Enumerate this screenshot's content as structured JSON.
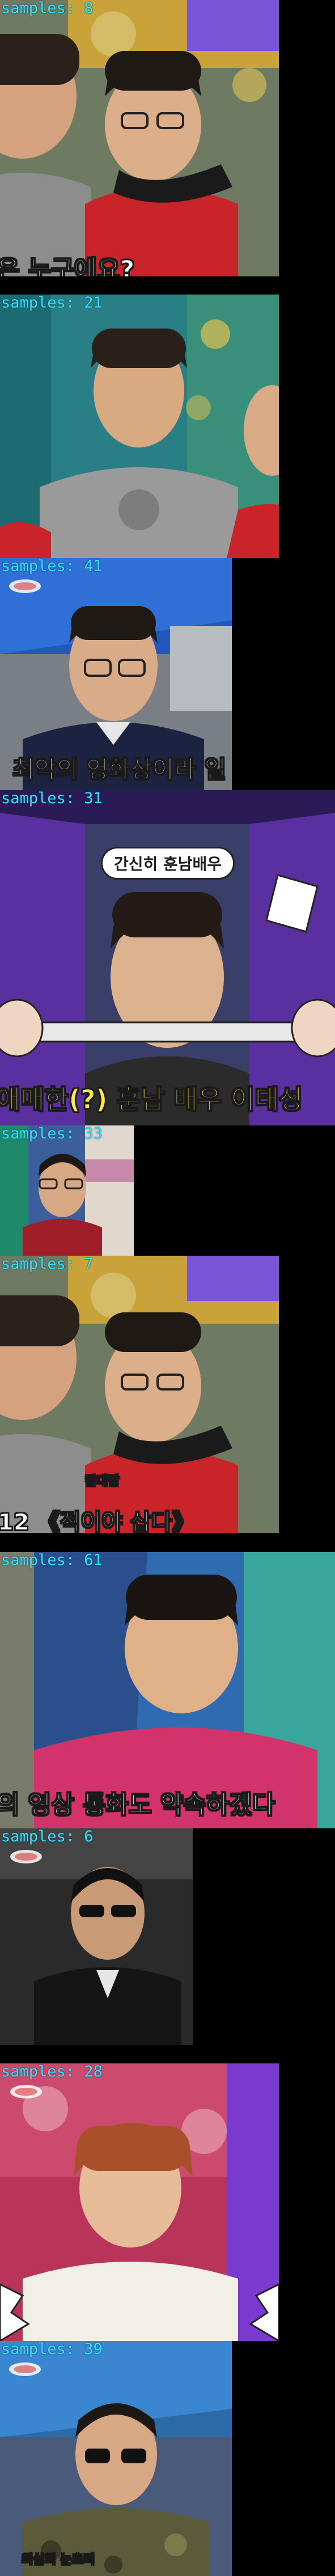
{
  "frames": [
    {
      "label": "samples: 8",
      "captions": [
        "은 누구예요?"
      ],
      "colors": {
        "bg": "#6f7a62",
        "accent": "#c8242a"
      }
    },
    {
      "label": "samples: 21",
      "captions": [],
      "colors": {
        "bg": "#2a7f86",
        "accent": "#c8242a"
      }
    },
    {
      "label": "samples: 41",
      "captions": [
        "최악의 영화상이라 일"
      ],
      "colors": {
        "bg": "#2358b8",
        "accent": "#1c2340"
      }
    },
    {
      "label": "samples: 31",
      "captions": [
        "간신히 훈남배우",
        "애매한(?) 훈남 배우 이태성"
      ],
      "colors": {
        "bg": "#5a2fa0",
        "accent": "#2b2b2b"
      }
    },
    {
      "label": "samples: 33",
      "captions": [],
      "colors": {
        "bg": "#3a5f9a",
        "accent": "#a01e2a"
      }
    },
    {
      "label": "samples: 7",
      "captions": [
        "칼대답",
        "12 《적이야 삽다》"
      ],
      "colors": {
        "bg": "#6f7a62",
        "accent": "#c8242a"
      }
    },
    {
      "label": "samples: 61",
      "captions": [
        "의 영상 통화도 약속하겠다"
      ],
      "colors": {
        "bg": "#2f6bb0",
        "accent": "#d2336b"
      }
    },
    {
      "label": "samples: 6",
      "captions": [],
      "colors": {
        "bg": "#2a2a2a",
        "accent": "#151515"
      }
    },
    {
      "label": "samples: 28",
      "captions": [],
      "colors": {
        "bg": "#b8345a",
        "accent": "#f2efe6"
      }
    },
    {
      "label": "samples: 39",
      "captions": [
        "의심의 눈초리"
      ],
      "colors": {
        "bg": "#2d6aa8",
        "accent": "#5b5a3a"
      }
    }
  ]
}
